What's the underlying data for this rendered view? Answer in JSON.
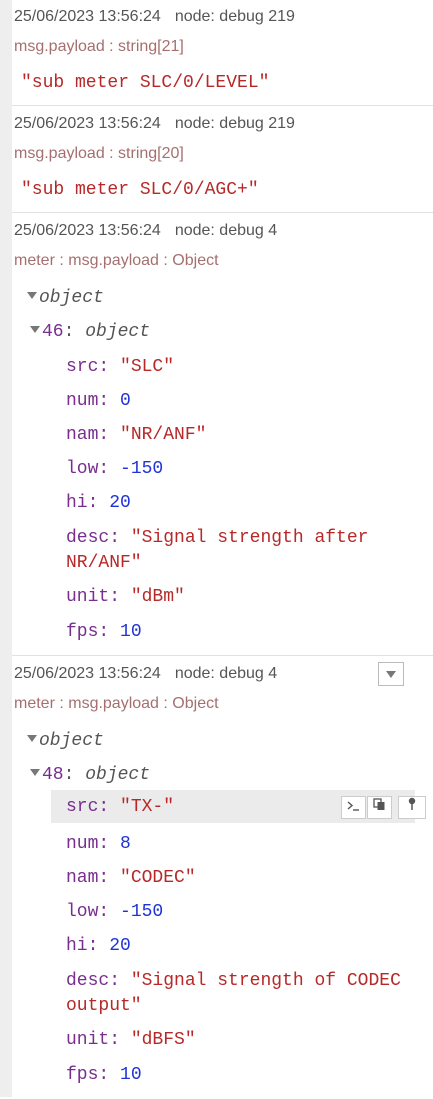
{
  "messages": [
    {
      "timestamp": "25/06/2023 13:56:24",
      "node": "node: debug 219",
      "topic": "msg.payload : string[21]",
      "payload": "\"sub meter SLC/0/LEVEL\""
    },
    {
      "timestamp": "25/06/2023 13:56:24",
      "node": "node: debug 219",
      "topic": "msg.payload : string[20]",
      "payload": "\"sub meter SLC/0/AGC+\""
    },
    {
      "timestamp": "25/06/2023 13:56:24",
      "node": "node: debug 4",
      "topic": "meter : msg.payload : Object",
      "root_label": "object",
      "child_key": "46",
      "child_type": "object",
      "props": {
        "src_key": "src:",
        "src_val": "\"SLC\"",
        "num_key": "num:",
        "num_val": "0",
        "nam_key": "nam:",
        "nam_val": "\"NR/ANF\"",
        "low_key": "low:",
        "low_val": "-150",
        "hi_key": "hi:",
        "hi_val": "20",
        "desc_key": "desc:",
        "desc_val_1": "\"Signal strength after",
        "desc_val_2": "NR/ANF\"",
        "unit_key": "unit:",
        "unit_val": "\"dBm\"",
        "fps_key": "fps:",
        "fps_val": "10"
      }
    },
    {
      "timestamp": "25/06/2023 13:56:24",
      "node": "node: debug 4",
      "topic": "meter : msg.payload : Object",
      "root_label": "object",
      "child_key": "48",
      "child_type": "object",
      "props": {
        "src_key": "src:",
        "src_val": "\"TX-\"",
        "num_key": "num:",
        "num_val": "8",
        "nam_key": "nam:",
        "nam_val": "\"CODEC\"",
        "low_key": "low:",
        "low_val": "-150",
        "hi_key": "hi:",
        "hi_val": "20",
        "desc_key": "desc:",
        "desc_val_1": "\"Signal strength of CODEC",
        "desc_val_2": "output\"",
        "unit_key": "unit:",
        "unit_val": "\"dBFS\"",
        "fps_key": "fps:",
        "fps_val": "10"
      }
    }
  ],
  "icons": {
    "copy_path": "terminal-icon",
    "copy_value": "copy-icon",
    "pin": "pin-icon",
    "menu": "chevron-down-icon"
  }
}
